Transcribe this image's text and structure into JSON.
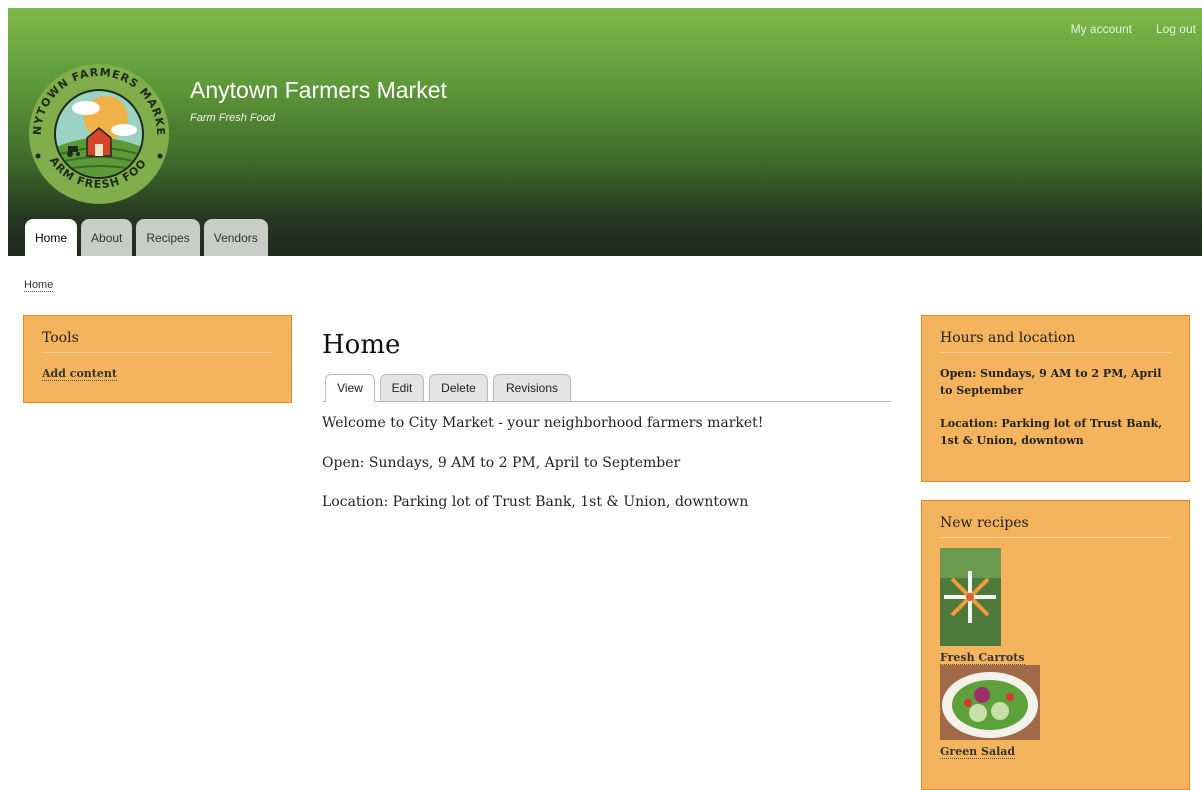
{
  "secondary_nav": [
    "My account",
    "Log out"
  ],
  "site": {
    "name": "Anytown Farmers Market",
    "slogan": "Farm Fresh Food",
    "logo_text_top": "ANYTOWN FARMERS MARKET",
    "logo_text_bottom": "FARM FRESH FOOD"
  },
  "main_menu": [
    {
      "label": "Home",
      "active": true
    },
    {
      "label": "About",
      "active": false
    },
    {
      "label": "Recipes",
      "active": false
    },
    {
      "label": "Vendors",
      "active": false
    }
  ],
  "breadcrumb": "Home",
  "tools": {
    "title": "Tools",
    "link": "Add content"
  },
  "page": {
    "title": "Home",
    "tabs": [
      "View",
      "Edit",
      "Delete",
      "Revisions"
    ],
    "paragraphs": [
      "Welcome to City Market - your neighborhood farmers market!",
      "Open: Sundays, 9 AM to 2 PM, April to September",
      "Location: Parking lot of Trust Bank, 1st & Union, downtown"
    ]
  },
  "hours": {
    "title": "Hours and location",
    "open": "Open: Sundays, 9 AM to 2 PM, April to September",
    "location": "Location: Parking lot of Trust Bank, 1st & Union, downtown"
  },
  "new_recipes": {
    "title": "New recipes",
    "items": [
      "Fresh Carrots",
      "Green Salad"
    ]
  },
  "colors": {
    "header_top": "#7db94a",
    "header_bottom": "#1e2a1c",
    "block_bg": "#f4b45e",
    "block_border": "#e6842a"
  }
}
